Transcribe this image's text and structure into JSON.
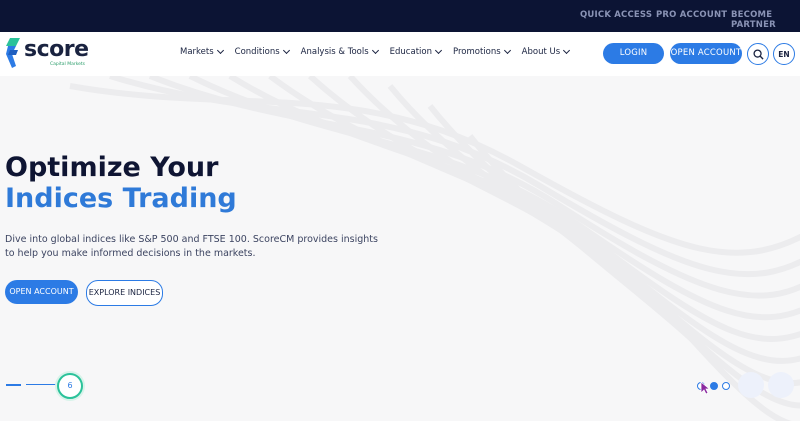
{
  "topbar": {
    "links": [
      "QUICK ACCESS",
      "PRO ACCOUNT",
      "BECOME PARTNER"
    ]
  },
  "brand": {
    "name": "score",
    "tagline": "Capital Markets"
  },
  "nav": {
    "items": [
      "Markets",
      "Conditions",
      "Analysis & Tools",
      "Education",
      "Promotions",
      "About Us"
    ]
  },
  "header_actions": {
    "login": "LOGIN",
    "open_account": "OPEN ACCOUNT",
    "search_icon": "search-icon",
    "language": "EN"
  },
  "hero": {
    "title_line1": "Optimize Your",
    "title_line2": "Indices Trading",
    "description": "Dive into global indices like S&P 500 and FTSE 100. ScoreCM provides insights to help you make informed decisions in the markets.",
    "primary_cta": "OPEN ACCOUNT",
    "secondary_cta": "EXPLORE INDICES"
  },
  "slider": {
    "counter": "6",
    "dot_count": 3,
    "active_dot": 2
  },
  "colors": {
    "topbar": "#0c1434",
    "accent": "#2c7be5",
    "title_blue": "#2f7ad8",
    "counter_ring": "#2bc29a"
  }
}
